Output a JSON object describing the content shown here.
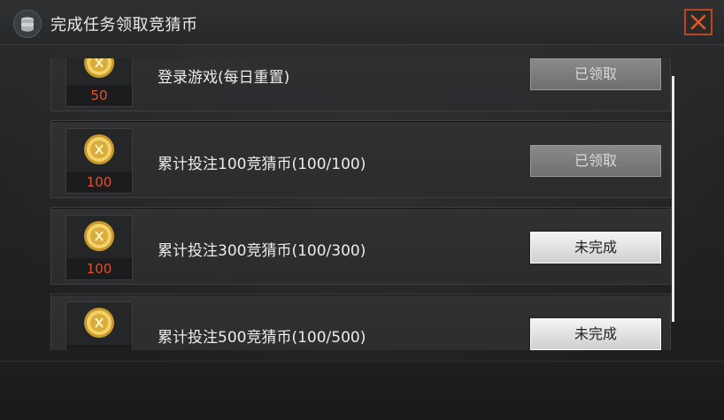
{
  "header": {
    "title": "完成任务领取竞猜币",
    "icon": "coins-icon",
    "close_icon": "close-icon",
    "accent": "#b6491f"
  },
  "colors": {
    "amount_text": "#e0522b",
    "claimed_button": "#7d7d7d",
    "incomplete_button": "#e6e6e6"
  },
  "tasks": [
    {
      "reward": "50",
      "label": "登录游戏(每日重置)",
      "status": "已领取",
      "state": "claimed"
    },
    {
      "reward": "100",
      "label": "累计投注100竞猜币(100/100)",
      "status": "已领取",
      "state": "claimed"
    },
    {
      "reward": "100",
      "label": "累计投注300竞猜币(100/300)",
      "status": "未完成",
      "state": "incomplete"
    },
    {
      "reward": "",
      "label": "累计投注500竞猜币(100/500)",
      "status": "未完成",
      "state": "incomplete"
    }
  ]
}
